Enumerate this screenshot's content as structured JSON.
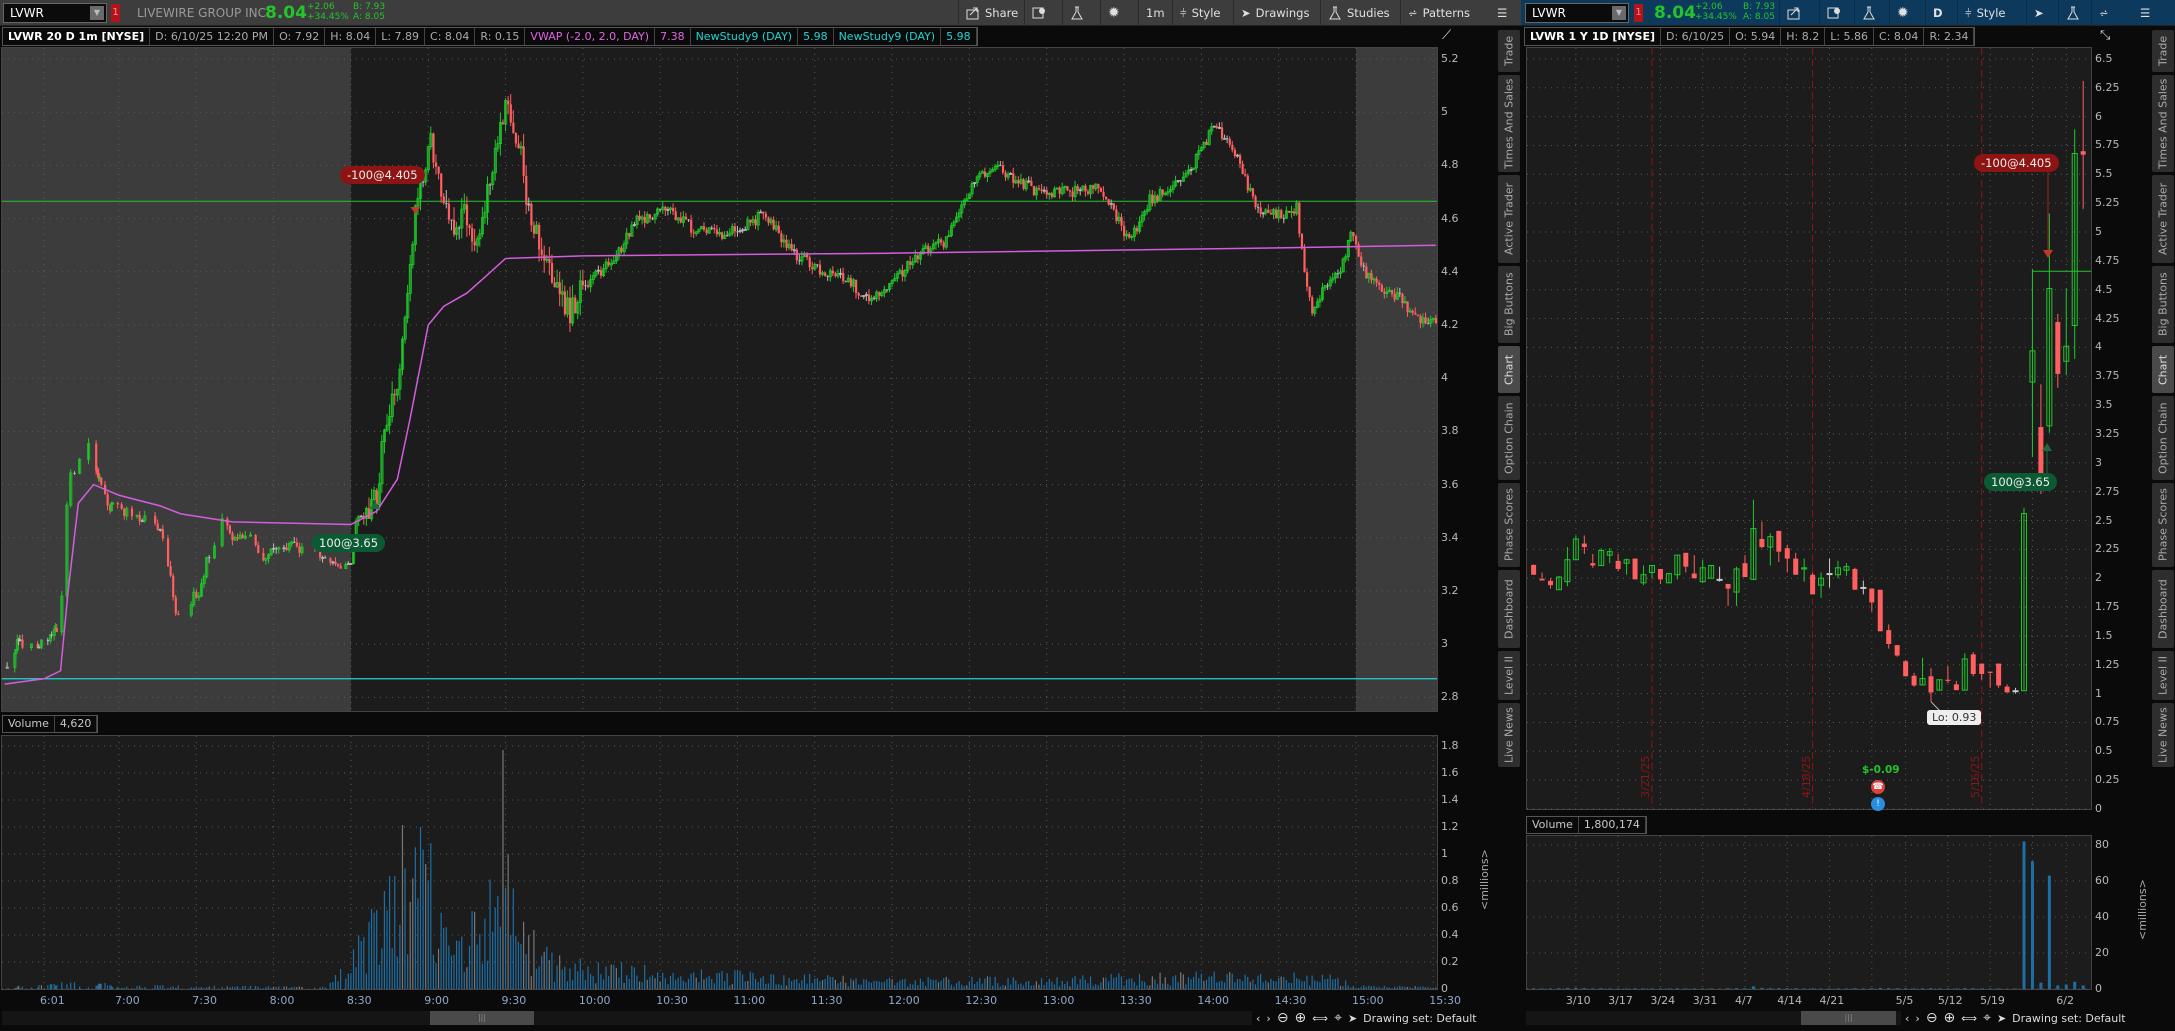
{
  "left": {
    "toolbar": {
      "symbol": "LVWR",
      "alert_badge": "1",
      "company": "LIVEWIRE GROUP INC",
      "last": "8.04",
      "change": "+2.06",
      "change_pct": "+34.45%",
      "bid": "B: 7.93",
      "ask": "A: 8.05",
      "buttons": {
        "share": "Share",
        "interval": "1m",
        "style": "Style",
        "drawings": "Drawings",
        "studies": "Studies",
        "patterns": "Patterns"
      }
    },
    "info": {
      "title": "LVWR 20 D 1m [NYSE]",
      "date": "D: 6/10/25 12:20 PM",
      "open": "O: 7.92",
      "high": "H: 8.04",
      "low": "L: 7.89",
      "close": "C: 8.04",
      "range": "R: 0.15",
      "vwap_label": "VWAP (-2.0, 2.0, DAY)",
      "vwap_value": "7.38",
      "study1_label": "NewStudy9 (DAY)",
      "study1_value": "5.98",
      "study2_label": "NewStudy9 (DAY)",
      "study2_value": "5.98"
    },
    "volume_header": {
      "label": "Volume",
      "value": "4,620"
    },
    "volume_unit": "<millions>",
    "drawing_set": "Drawing set: Default",
    "orders": [
      {
        "label": "-100@4.405",
        "side": "sell"
      },
      {
        "label": "100@3.65",
        "side": "buy"
      }
    ]
  },
  "right": {
    "toolbar": {
      "symbol": "LVWR",
      "alert_badge": "1",
      "last": "8.04",
      "change": "+2.06",
      "change_pct": "+34.45%",
      "bid": "B: 7.93",
      "ask": "A: 8.05",
      "interval": "D",
      "style": "Style"
    },
    "info": {
      "title": "LVWR 1 Y 1D [NYSE]",
      "date": "D: 6/10/25",
      "open": "O: 5.94",
      "high": "H: 8.2",
      "low": "L: 5.86",
      "close": "C: 8.04",
      "range": "R: 2.34"
    },
    "volume_header": {
      "label": "Volume",
      "value": "1,800,174"
    },
    "volume_unit": "<millions>",
    "drawing_set": "Drawing set: Default",
    "orders": [
      {
        "label": "-100@4.405",
        "side": "sell"
      },
      {
        "label": "100@3.65",
        "side": "buy"
      }
    ],
    "low_label": "Lo: 0.93",
    "earnings": {
      "label": "$-0.09"
    },
    "expirations": [
      {
        "label": "3/21/25",
        "index": 14
      },
      {
        "label": "4/18/25",
        "index": 33
      },
      {
        "label": "5/16/25",
        "index": 53
      }
    ]
  },
  "side_tabs": [
    "Trade",
    "Times And Sales",
    "Active Trader",
    "Big Buttons",
    "Chart",
    "Option Chain",
    "Phase Scores",
    "Dashboard",
    "Level II",
    "Live News"
  ],
  "active_tab": "Chart",
  "colors": {
    "up": "#1fc82a",
    "down": "#ff5f5f",
    "vwap": "#d35ddb",
    "cyan": "#1ed6d6",
    "hline": "#22c52b",
    "volume": "#1c6fa6",
    "sell": "#8e1313",
    "buy": "#0c5a34",
    "premarket": "#3c3c3c",
    "plot": "#1c1c1c"
  },
  "chart_data": [
    {
      "type": "candlestick",
      "title": "LVWR 20 D 1m [NYSE]",
      "ylim": [
        2.8,
        5.2
      ],
      "y_ticks": [
        "5.2",
        "5",
        "4.8",
        "4.6",
        "4.4",
        "4.2",
        "4",
        "3.8",
        "3.6",
        "3.4",
        "3.2",
        "3",
        "2.8"
      ],
      "x_ticks": [
        "6:01",
        "7:00",
        "7:30",
        "8:00",
        "8:30",
        "9:00",
        "9:30",
        "10:00",
        "10:30",
        "11:00",
        "11:30",
        "12:00",
        "12:30",
        "13:00",
        "13:30",
        "14:00",
        "14:30",
        "15:00",
        "15:30"
      ],
      "regular_session": [
        "8:30",
        "15:00"
      ],
      "price_path": [
        [
          "5:32",
          2.9
        ],
        [
          "5:40",
          3.0
        ],
        [
          "6:00",
          3.0
        ],
        [
          "6:14",
          3.07
        ],
        [
          "6:15",
          3.2
        ],
        [
          "6:17",
          3.25
        ],
        [
          "6:20",
          3.64
        ],
        [
          "6:23",
          3.63
        ],
        [
          "6:35",
          3.79
        ],
        [
          "6:43",
          3.63
        ],
        [
          "6:53",
          3.52
        ],
        [
          "7:03",
          3.5
        ],
        [
          "7:08",
          3.48
        ],
        [
          "7:13",
          3.46
        ],
        [
          "7:17",
          3.4
        ],
        [
          "7:21",
          3.19
        ],
        [
          "7:22",
          3.12
        ],
        [
          "7:26",
          3.14
        ],
        [
          "7:31",
          3.2
        ],
        [
          "7:34",
          3.31
        ],
        [
          "7:38",
          3.39
        ],
        [
          "7:39",
          3.48
        ],
        [
          "7:44",
          3.41
        ],
        [
          "7:50",
          3.42
        ],
        [
          "7:54",
          3.35
        ],
        [
          "7:56",
          3.32
        ],
        [
          "8:01",
          3.36
        ],
        [
          "8:06",
          3.37
        ],
        [
          "8:10",
          3.36
        ],
        [
          "8:17",
          3.35
        ],
        [
          "8:21",
          3.29
        ],
        [
          "8:27",
          3.29
        ],
        [
          "8:30",
          3.31
        ],
        [
          "8:32",
          3.46
        ],
        [
          "8:36",
          3.48
        ],
        [
          "8:40",
          3.57
        ],
        [
          "8:42",
          3.72
        ],
        [
          "8:46",
          3.91
        ],
        [
          "8:49",
          4.0
        ],
        [
          "8:55",
          4.64
        ],
        [
          "9:01",
          4.87
        ],
        [
          "9:03",
          4.77
        ],
        [
          "9:09",
          4.55
        ],
        [
          "9:14",
          4.64
        ],
        [
          "9:19",
          4.51
        ],
        [
          "9:25",
          4.77
        ],
        [
          "9:30",
          5.06
        ],
        [
          "9:36",
          4.85
        ],
        [
          "9:38",
          4.64
        ],
        [
          "9:49",
          4.33
        ],
        [
          "9:55",
          4.25
        ],
        [
          "10:00",
          4.35
        ],
        [
          "10:11",
          4.43
        ],
        [
          "10:21",
          4.59
        ],
        [
          "10:32",
          4.64
        ],
        [
          "10:43",
          4.56
        ],
        [
          "10:54",
          4.54
        ],
        [
          "11:10",
          4.61
        ],
        [
          "11:21",
          4.48
        ],
        [
          "11:31",
          4.41
        ],
        [
          "11:42",
          4.38
        ],
        [
          "11:50",
          4.3
        ],
        [
          "11:58",
          4.33
        ],
        [
          "12:09",
          4.46
        ],
        [
          "12:20",
          4.51
        ],
        [
          "12:31",
          4.72
        ],
        [
          "12:39",
          4.8
        ],
        [
          "12:47",
          4.75
        ],
        [
          "12:57",
          4.7
        ],
        [
          "13:08",
          4.7
        ],
        [
          "13:19",
          4.72
        ],
        [
          "13:27",
          4.61
        ],
        [
          "13:32",
          4.51
        ],
        [
          "13:40",
          4.67
        ],
        [
          "13:49",
          4.72
        ],
        [
          "13:57",
          4.8
        ],
        [
          "14:05",
          4.95
        ],
        [
          "14:13",
          4.85
        ],
        [
          "14:21",
          4.64
        ],
        [
          "14:29",
          4.61
        ],
        [
          "14:37",
          4.64
        ],
        [
          "14:40",
          4.38
        ],
        [
          "14:43",
          4.25
        ],
        [
          "14:48",
          4.35
        ],
        [
          "14:53",
          4.38
        ],
        [
          "14:58",
          4.54
        ],
        [
          "15:04",
          4.38
        ],
        [
          "15:09",
          4.35
        ],
        [
          "15:17",
          4.3
        ],
        [
          "15:23",
          4.22
        ],
        [
          "15:31",
          4.22
        ]
      ],
      "vwap": [
        [
          "5:30",
          2.85
        ],
        [
          "6:01",
          2.87
        ],
        [
          "6:14",
          2.9
        ],
        [
          "6:20",
          3.2
        ],
        [
          "6:28",
          3.53
        ],
        [
          "6:40",
          3.6
        ],
        [
          "7:00",
          3.56
        ],
        [
          "7:16",
          3.52
        ],
        [
          "7:24",
          3.49
        ],
        [
          "7:44",
          3.46
        ],
        [
          "8:30",
          3.45
        ],
        [
          "8:40",
          3.5
        ],
        [
          "8:48",
          3.62
        ],
        [
          "8:53",
          3.85
        ],
        [
          "9:00",
          4.2
        ],
        [
          "9:06",
          4.27
        ],
        [
          "9:15",
          4.32
        ],
        [
          "9:22",
          4.38
        ],
        [
          "9:30",
          4.45
        ],
        [
          "10:00",
          4.46
        ],
        [
          "12:00",
          4.47
        ],
        [
          "14:30",
          4.49
        ],
        [
          "15:31",
          4.5
        ]
      ],
      "horizontal_lines": [
        4.665,
        2.87
      ],
      "volume": {
        "ylim": [
          0,
          1.8
        ],
        "y_ticks": [
          "1.8",
          "1.6",
          "1.4",
          "1.2",
          "1",
          "0.8",
          "0.6",
          "0.4",
          "0.2",
          "0"
        ],
        "path": [
          [
            "5:32",
            0.01
          ],
          [
            "6:30",
            0.04
          ],
          [
            "7:00",
            0.02
          ],
          [
            "8:20",
            0.01
          ],
          [
            "8:30",
            0.15
          ],
          [
            "8:45",
            0.6
          ],
          [
            "8:55",
            0.9
          ],
          [
            "9:05",
            0.55
          ],
          [
            "9:15",
            0.3
          ],
          [
            "9:28",
            0.8
          ],
          [
            "9:35",
            0.35
          ],
          [
            "9:50",
            0.15
          ],
          [
            "10:30",
            0.1
          ],
          [
            "12:00",
            0.05
          ],
          [
            "13:00",
            0.06
          ],
          [
            "14:00",
            0.08
          ],
          [
            "14:50",
            0.07
          ],
          [
            "15:00",
            0.02
          ],
          [
            "15:31",
            0.01
          ]
        ],
        "peaks": [
          [
            "8:55",
            1.05
          ],
          [
            "8:57",
            1.2
          ],
          [
            "9:29",
            1.77
          ],
          [
            "9:31",
            1.0
          ]
        ]
      }
    },
    {
      "type": "candlestick",
      "title": "LVWR 1 Y 1D [NYSE]",
      "ylim": [
        0,
        6.5
      ],
      "y_ticks": [
        "6.5",
        "6.25",
        "6",
        "5.75",
        "5.5",
        "5.25",
        "5",
        "4.75",
        "4.5",
        "4.25",
        "4",
        "3.75",
        "3.5",
        "3.25",
        "3",
        "2.75",
        "2.5",
        "2.25",
        "2",
        "1.75",
        "1.5",
        "1.25",
        "1",
        "0.75",
        "0.5",
        "0.25",
        "0"
      ],
      "x_ticks": [
        [
          "3/10",
          5
        ],
        [
          "3/17",
          10
        ],
        [
          "3/24",
          15
        ],
        [
          "3/31",
          20
        ],
        [
          "4/7",
          25
        ],
        [
          "4/14",
          30
        ],
        [
          "4/21",
          35
        ],
        [
          "",
          40
        ],
        [
          "5/5",
          44
        ],
        [
          "5/12",
          49
        ],
        [
          "5/19",
          54
        ],
        [
          "",
          59
        ],
        [
          "6/2",
          63
        ]
      ],
      "ohlc": [
        [
          2.115,
          2.12,
          2.03,
          2.03
        ],
        [
          1.995,
          2.05,
          1.98,
          1.98
        ],
        [
          1.977,
          2.0,
          1.91,
          1.94
        ],
        [
          1.9,
          2.02,
          1.9,
          2.01
        ],
        [
          1.97,
          2.27,
          1.93,
          2.16
        ],
        [
          2.16,
          2.37,
          2.16,
          2.34
        ],
        [
          2.3,
          2.37,
          2.21,
          2.27
        ],
        [
          2.13,
          2.21,
          2.09,
          2.11
        ],
        [
          2.11,
          2.26,
          2.11,
          2.24
        ],
        [
          2.2,
          2.26,
          2.13,
          2.23
        ],
        [
          2.15,
          2.21,
          2.06,
          2.08
        ],
        [
          2.13,
          2.17,
          2.03,
          2.16
        ],
        [
          2.17,
          2.17,
          1.99,
          1.99
        ],
        [
          1.96,
          2.11,
          1.94,
          2.03
        ],
        [
          2.05,
          2.11,
          2.0,
          2.11
        ],
        [
          2.08,
          2.08,
          1.95,
          1.99
        ],
        [
          1.96,
          2.04,
          1.96,
          2.04
        ],
        [
          2.03,
          2.2,
          1.99,
          2.2
        ],
        [
          2.22,
          2.22,
          2.05,
          2.1
        ],
        [
          2.04,
          2.2,
          2.0,
          2.0
        ],
        [
          1.97,
          2.16,
          1.96,
          2.09
        ],
        [
          2.0,
          2.11,
          2.0,
          2.11
        ],
        [
          1.99,
          2.1,
          1.97,
          1.99
        ],
        [
          1.95,
          1.95,
          1.76,
          1.91
        ],
        [
          1.88,
          2.1,
          1.76,
          2.08
        ],
        [
          2.13,
          2.2,
          2.01,
          2.01
        ],
        [
          1.99,
          2.68,
          1.99,
          2.43
        ],
        [
          2.34,
          2.49,
          2.26,
          2.27
        ],
        [
          2.27,
          2.39,
          2.11,
          2.36
        ],
        [
          2.41,
          2.41,
          2.14,
          2.23
        ],
        [
          2.26,
          2.29,
          2.05,
          2.17
        ],
        [
          2.17,
          2.22,
          2.03,
          2.03
        ],
        [
          2.08,
          2.17,
          1.97,
          2.09
        ],
        [
          2.03,
          2.05,
          1.86,
          1.86
        ],
        [
          1.94,
          2.05,
          1.83,
          2.0
        ],
        [
          2.04,
          2.17,
          1.92,
          2.04
        ],
        [
          2.03,
          2.15,
          2.0,
          2.09
        ],
        [
          2.07,
          2.13,
          2.02,
          2.1
        ],
        [
          2.08,
          2.09,
          1.9,
          1.9
        ],
        [
          1.92,
          1.98,
          1.86,
          1.92
        ],
        [
          1.91,
          1.91,
          1.71,
          1.79
        ],
        [
          1.9,
          1.9,
          1.54,
          1.54
        ],
        [
          1.55,
          1.6,
          1.39,
          1.43
        ],
        [
          1.42,
          1.42,
          1.32,
          1.33
        ],
        [
          1.28,
          1.29,
          1.15,
          1.15
        ],
        [
          1.155,
          1.18,
          1.06,
          1.07
        ],
        [
          1.075,
          1.31,
          1.075,
          1.13
        ],
        [
          1.15,
          1.22,
          0.93,
          1.01
        ],
        [
          1.03,
          1.12,
          1.03,
          1.12
        ],
        [
          1.12,
          1.24,
          1.09,
          1.11
        ],
        [
          1.08,
          1.11,
          1.03,
          1.03
        ],
        [
          1.03,
          1.35,
          1.03,
          1.3
        ],
        [
          1.34,
          1.36,
          1.15,
          1.17
        ],
        [
          1.26,
          1.26,
          1.12,
          1.17
        ],
        [
          1.19,
          1.19,
          1.05,
          1.18
        ],
        [
          1.26,
          1.26,
          1.05,
          1.07
        ],
        [
          1.06,
          1.08,
          1.01,
          1.01
        ],
        [
          1.025,
          1.05,
          1.0,
          1.025
        ],
        [
          1.025,
          2.61,
          1.025,
          2.56
        ],
        [
          3.7,
          4.68,
          3.05,
          3.97
        ],
        [
          3.31,
          3.68,
          2.73,
          2.9
        ],
        [
          3.32,
          5.16,
          3.26,
          4.51
        ],
        [
          4.22,
          4.29,
          3.65,
          3.77
        ],
        [
          3.88,
          4.51,
          3.76,
          4.01
        ],
        [
          4.19,
          5.89,
          3.9,
          5.68
        ],
        [
          5.7,
          6.31,
          5.2,
          5.67
        ]
      ],
      "horizontal_line": {
        "value": 4.66,
        "from_index": 59
      },
      "volume": {
        "ylim": [
          0,
          90
        ],
        "y_ticks": [
          "80",
          "60",
          "40",
          "20",
          "0"
        ],
        "values": [
          0.4,
          0.3,
          0.3,
          0.4,
          0.6,
          0.7,
          0.5,
          0.3,
          0.4,
          0.3,
          0.3,
          0.3,
          0.4,
          0.3,
          0.3,
          0.3,
          0.3,
          0.4,
          0.3,
          0.3,
          0.3,
          0.3,
          0.2,
          0.4,
          0.5,
          0.4,
          1.5,
          0.6,
          0.5,
          0.5,
          0.4,
          0.4,
          0.3,
          0.4,
          0.3,
          0.3,
          0.3,
          0.3,
          0.4,
          0.3,
          0.4,
          0.6,
          0.5,
          0.4,
          0.4,
          0.3,
          0.4,
          0.5,
          0.3,
          0.3,
          0.3,
          0.5,
          0.4,
          0.3,
          0.3,
          0.3,
          0.2,
          0.2,
          82,
          71,
          3.5,
          63,
          2,
          2.5,
          4,
          2
        ]
      }
    }
  ]
}
